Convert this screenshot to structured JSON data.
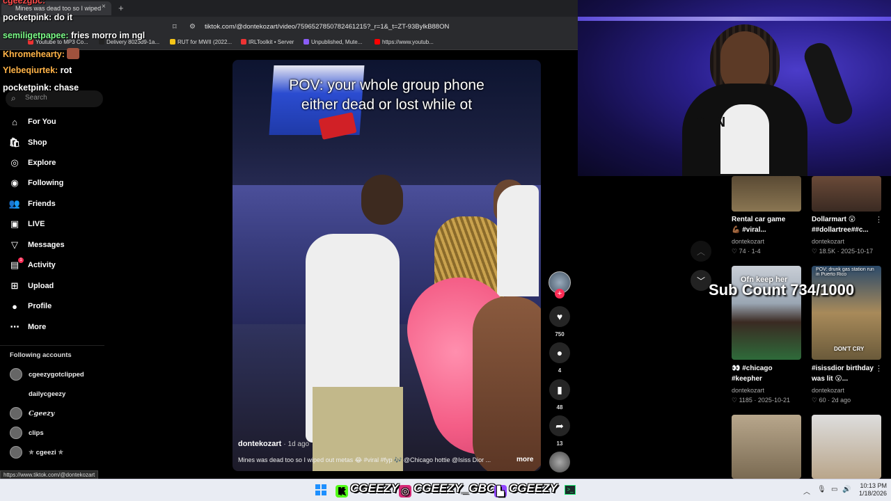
{
  "browser": {
    "tab_title": "Mines was dead too so I wiped",
    "tab_close": "×",
    "new_tab": "+",
    "url": "tiktok.com/@dontekozart/video/7596527850782461215?_r=1&_t=ZT-93BylkB88ON",
    "bookmarks": [
      "Youtube to MP3 Co...",
      "Delivery 8023d9-1a...",
      "RUT for MWII (2022...",
      "IRLToolkit • Server",
      "Unpublished, Mute...",
      "https://www.youtub..."
    ],
    "status_url": "https://www.tiktok.com/@dontekozart"
  },
  "chat": [
    {
      "name": "cgeezgbc:",
      "msg": ""
    },
    {
      "name": "pocketpink:",
      "msg": "do it"
    },
    {
      "name": "semiligetpapee:",
      "msg": "fries morro im ngl"
    },
    {
      "name": "Khromehearty:",
      "msg": ""
    },
    {
      "name": "Ylebeqiurtek:",
      "msg": "rot"
    },
    {
      "name": "pocketpink:",
      "msg": "chase"
    }
  ],
  "sidebar": {
    "search_placeholder": "Search",
    "items": [
      {
        "label": "For You",
        "icon": "home-icon"
      },
      {
        "label": "Shop",
        "icon": "shop-icon"
      },
      {
        "label": "Explore",
        "icon": "compass-icon"
      },
      {
        "label": "Following",
        "icon": "following-icon"
      },
      {
        "label": "Friends",
        "icon": "friends-icon"
      },
      {
        "label": "LIVE",
        "icon": "live-icon"
      },
      {
        "label": "Messages",
        "icon": "messages-icon"
      },
      {
        "label": "Activity",
        "icon": "activity-icon"
      },
      {
        "label": "Upload",
        "icon": "upload-icon"
      },
      {
        "label": "Profile",
        "icon": "profile-icon"
      },
      {
        "label": "More",
        "icon": "more-icon"
      }
    ],
    "activity_badge": "1",
    "following_title": "Following accounts",
    "following": [
      "cgeezygotclipped",
      "dailycgeezy",
      "Cgeezy",
      "clips",
      "✯ cgeezi ✯"
    ]
  },
  "video": {
    "caption_line1": "POV: your whole group phone",
    "caption_line2": "either dead or lost while ot",
    "author": "dontekozart",
    "age": "· 1d ago",
    "description": "Mines was dead too so I wiped out metas 😂 #viral #fyp 🎶 @Chicago hottie @Isiss Dior ...",
    "more": "more",
    "likes": "750",
    "comments": "4",
    "saves": "48",
    "shares": "13"
  },
  "feed": [
    {
      "title1": "Rental car game",
      "title2": "💪🏾 #viral...",
      "author": "dontekozart",
      "stats": "♡ 74 · 1-4"
    },
    {
      "title1": "Dollarmart 😮",
      "title2": "##dollartree##c...",
      "author": "dontekozart",
      "stats": "♡ 18.5K · 2025-10-17"
    },
    {
      "title1": "👀 #chicago",
      "title2": "#keepher",
      "author": "dontekozart",
      "stats": "♡ 1185 · 2025-10-21"
    },
    {
      "title1": "#isissdior birthday",
      "title2": "was lit 😮...",
      "author": "dontekozart",
      "stats": "♡ 60 · 2d ago"
    }
  ],
  "thumb_texts": {
    "keep_her": "Ofn keep her",
    "gas_station": "POV: drunk gas station run in Puerto Rico",
    "dont_cry": "DON'T CRY"
  },
  "overlay": {
    "sub_count": "Sub Count 734/1000",
    "socials": [
      {
        "icon": "kick-icon",
        "label": "CGEEZY",
        "color": "#53fc18"
      },
      {
        "icon": "instagram-icon",
        "label": "CGEEZY_GBC",
        "color": "#d62976"
      },
      {
        "icon": "twitch-icon",
        "label": "CGEEZY",
        "color": "#9146ff"
      }
    ],
    "webcam_text": "DEN"
  },
  "taskbar": {
    "time": "10:13 PM",
    "date": "1/18/2026"
  }
}
